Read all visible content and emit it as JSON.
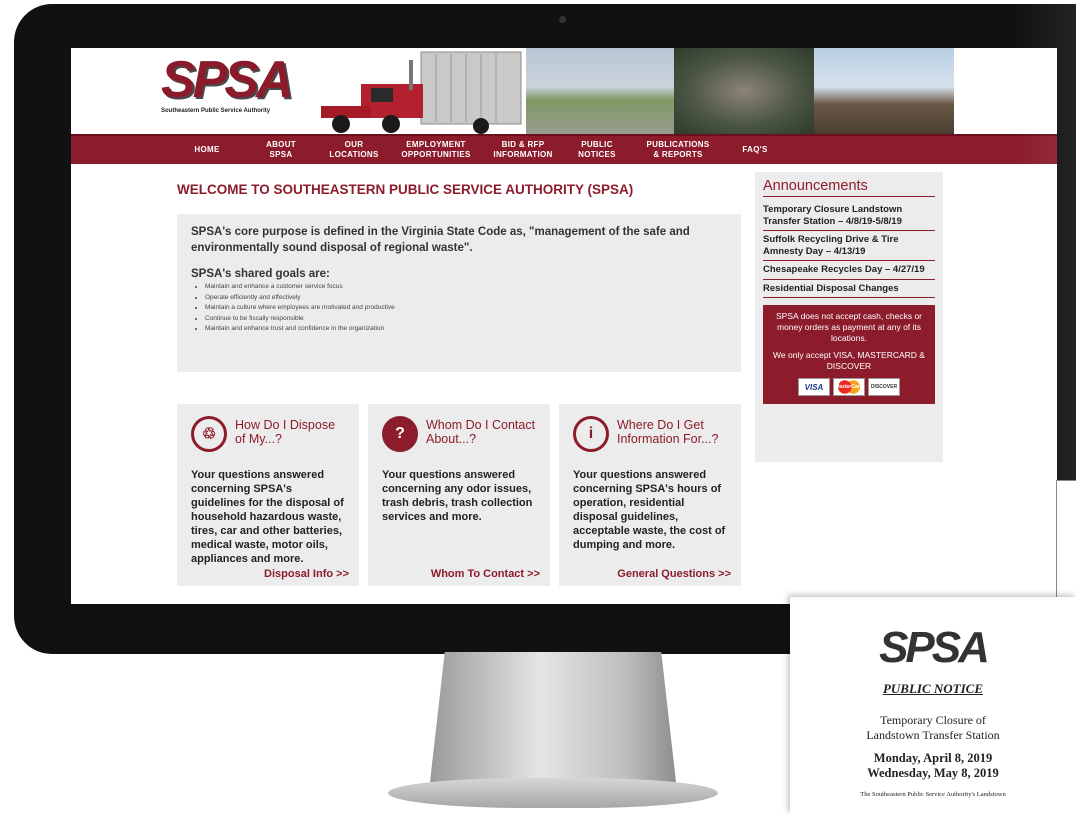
{
  "site": {
    "logo_text": "SPSA",
    "logo_subtitle": "Southeastern Public Service Authority"
  },
  "nav": {
    "items": [
      {
        "label": "HOME"
      },
      {
        "label": "ABOUT\nSPSA"
      },
      {
        "label": "OUR\nLOCATIONS"
      },
      {
        "label": "EMPLOYMENT\nOPPORTUNITIES"
      },
      {
        "label": "BID & RFP\nINFORMATION"
      },
      {
        "label": "PUBLIC\nNOTICES"
      },
      {
        "label": "PUBLICATIONS\n& REPORTS"
      },
      {
        "label": "FAQ'S"
      }
    ]
  },
  "main": {
    "welcome_title": "WELCOME TO SOUTHEASTERN PUBLIC SERVICE AUTHORITY (SPSA)",
    "intro": "SPSA's core purpose is defined in the Virginia State Code as, \"management of the safe and environmentally sound disposal of regional waste\".",
    "goals_title": "SPSA's shared goals are:",
    "goals": [
      "Maintain and enhance a customer service focus",
      "Operate efficiently and effectively",
      "Maintain a culture where employees are motivated and productive",
      "Continue to be fiscally responsible",
      "Maintain and enhance trust and confidence in the organization"
    ],
    "cards": [
      {
        "title": "How Do I Dispose of My...?",
        "body": "Your questions answered concerning SPSA's guidelines for the disposal of household hazardous waste, tires, car and other batteries, medical waste, motor oils, appliances and more.",
        "link": "Disposal Info >>"
      },
      {
        "title": "Whom Do I Contact About...?",
        "body": "Your questions answered concerning any odor issues, trash debris, trash collection services and more.",
        "link": "Whom To Contact >>"
      },
      {
        "title": "Where Do I Get Information For...?",
        "body": "Your questions answered concerning SPSA's hours of operation, residential disposal guidelines, acceptable waste, the cost of dumping and more.",
        "link": "General Questions >>"
      }
    ]
  },
  "sidebar": {
    "title": "Announcements",
    "items": [
      "Temporary Closure Landstown Transfer Station – 4/8/19-5/8/19",
      "Suffolk Recycling Drive & Tire Amnesty Day – 4/13/19",
      "Chesapeake Recycles Day – 4/27/19",
      "Residential Disposal Changes"
    ],
    "payment_note": "SPSA does not accept cash, checks or money orders as payment at any of its locations.",
    "payment_accept": "We only accept VISA, MASTERCARD & DISCOVER",
    "cards": [
      "VISA",
      "MasterCard",
      "DISCOVER"
    ]
  },
  "notice": {
    "logo_text": "SPSA",
    "title": "PUBLIC NOTICE",
    "subtitle_line1": "Temporary Closure of",
    "subtitle_line2": "Landstown Transfer Station",
    "date_line1": "Monday, April 8, 2019",
    "date_line2": "Wednesday, May 8, 2019",
    "body": "The Southeastern Public Service Authority's Landstown"
  },
  "colors": {
    "brand": "#8c1c2c",
    "panel": "#ececec"
  }
}
